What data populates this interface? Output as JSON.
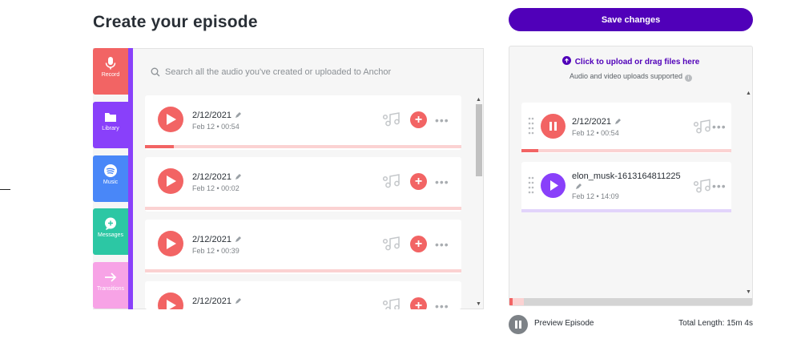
{
  "page": {
    "title": "Create your episode"
  },
  "sidebar": {
    "tabs": [
      {
        "label": "Record",
        "icon": "microphone-icon",
        "color": "#f26464"
      },
      {
        "label": "Library",
        "icon": "folder-icon",
        "color": "#8940fa"
      },
      {
        "label": "Music",
        "icon": "spotify-icon",
        "color": "#4987f8"
      },
      {
        "label": "Messages",
        "icon": "message-icon",
        "color": "#2cc7a4"
      },
      {
        "label": "Transitions",
        "icon": "arrow-right-icon",
        "color": "#f7a3e6"
      }
    ],
    "active": "Library"
  },
  "library": {
    "search_placeholder": "Search all the audio you've created or uploaded to Anchor",
    "episodes": [
      {
        "title": "2/12/2021",
        "meta": "Feb 12 • 00:54",
        "progress": 0.09
      },
      {
        "title": "2/12/2021",
        "meta": "Feb 12 • 00:02",
        "progress": 0
      },
      {
        "title": "2/12/2021",
        "meta": "Feb 12 • 00:39",
        "progress": 0
      },
      {
        "title": "2/12/2021",
        "meta": "",
        "progress": 0
      }
    ],
    "add_symbol": "+",
    "more_symbol": "•••"
  },
  "toolbar": {
    "save_label": "Save changes"
  },
  "upload": {
    "label": "Click to upload or drag files here",
    "sub": "Audio and video uploads supported",
    "info_symbol": "i"
  },
  "timeline": {
    "items": [
      {
        "title": "2/12/2021",
        "meta": "Feb 12 • 00:54",
        "state": "playing",
        "color": "#f26464",
        "bar_color": "#fbd2d2",
        "progress": 0.08
      },
      {
        "title": "elon_musk-1613164811225",
        "meta": "Feb 12 • 14:09",
        "state": "paused",
        "color": "#8940fa",
        "bar_color": "#e2d4fb",
        "progress": 0
      }
    ]
  },
  "footer": {
    "preview_label": "Preview Episode",
    "total_length": "Total Length: 15m 4s"
  },
  "colors": {
    "brand": "#5000b9",
    "record": "#f26464",
    "library": "#8940fa"
  }
}
